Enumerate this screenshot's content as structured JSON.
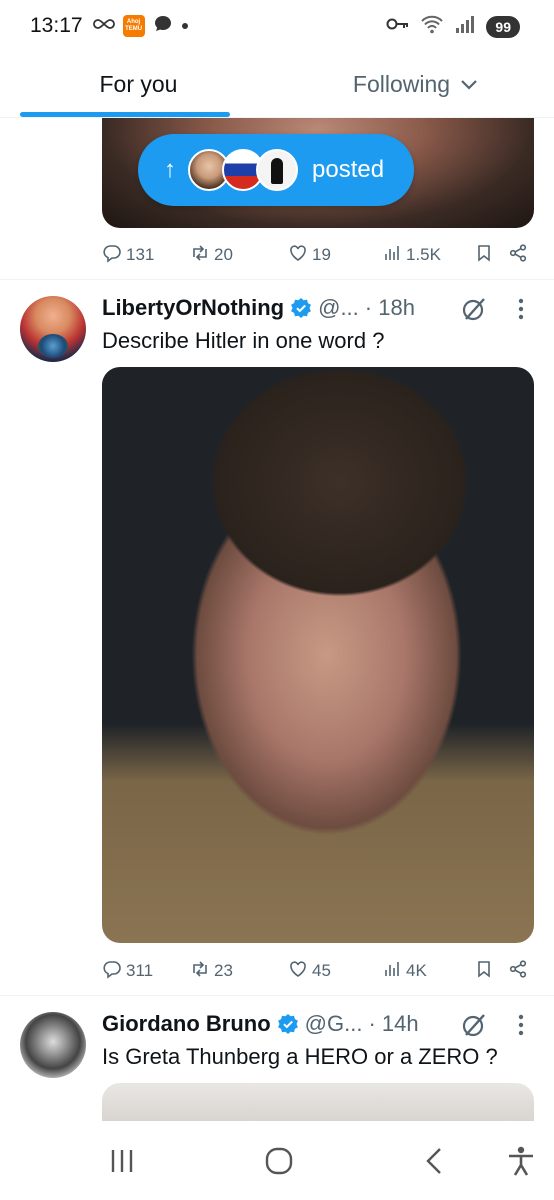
{
  "status_bar": {
    "time": "13:17",
    "temu_badge": "Ahoj TEMU",
    "battery": "99"
  },
  "tabs": [
    {
      "label": "For you",
      "active": true
    },
    {
      "label": "Following",
      "active": false
    }
  ],
  "previous_post": {
    "posted_pill_label": "posted",
    "actions": {
      "replies": "131",
      "reposts": "20",
      "likes": "19",
      "views": "1.5K"
    }
  },
  "tweets": [
    {
      "name": "LibertyOrNothing",
      "handle": "@...",
      "time": "· 18h",
      "text": "Describe Hitler in one word ?",
      "actions": {
        "replies": "311",
        "reposts": "23",
        "likes": "45",
        "views": "4K"
      }
    },
    {
      "name": "Giordano Bruno",
      "handle": "@G...",
      "time": "· 14h",
      "text": "Is Greta Thunberg a HERO or a ZERO ?"
    }
  ],
  "colors": {
    "accent": "#1d9bf0",
    "secondary_text": "#536471",
    "primary_text": "#0f1419",
    "divider": "#eff3f4"
  },
  "icons": [
    "infinity-icon",
    "temu-icon",
    "chat-bubble-icon",
    "key-icon",
    "wifi-icon",
    "signal-icon",
    "reply-icon",
    "repost-icon",
    "like-icon",
    "views-icon",
    "bookmark-icon",
    "share-icon",
    "verified-icon",
    "grok-icon",
    "more-icon",
    "recents-icon",
    "home-icon",
    "back-icon",
    "accessibility-icon"
  ]
}
